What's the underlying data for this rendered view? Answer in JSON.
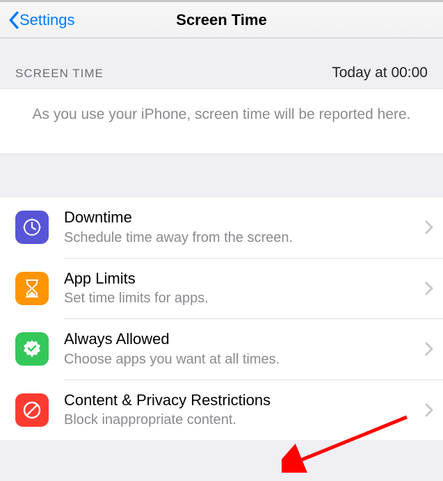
{
  "nav": {
    "back_label": "Settings",
    "title": "Screen Time"
  },
  "summary": {
    "header_left": "SCREEN TIME",
    "header_right": "Today at 00:00",
    "empty_text": "As you use your iPhone, screen time will be reported here."
  },
  "rows": [
    {
      "icon_name": "clock-icon",
      "icon_color": "#5856d6",
      "title": "Downtime",
      "subtitle": "Schedule time away from the screen."
    },
    {
      "icon_name": "hourglass-icon",
      "icon_color": "#ff9500",
      "title": "App Limits",
      "subtitle": "Set time limits for apps."
    },
    {
      "icon_name": "check-badge-icon",
      "icon_color": "#34c759",
      "title": "Always Allowed",
      "subtitle": "Choose apps you want at all times."
    },
    {
      "icon_name": "no-entry-icon",
      "icon_color": "#ff3b30",
      "title": "Content & Privacy Restrictions",
      "subtitle": "Block inappropriate content."
    }
  ],
  "annotation": {
    "type": "red-arrow",
    "target_row_index": 3
  }
}
